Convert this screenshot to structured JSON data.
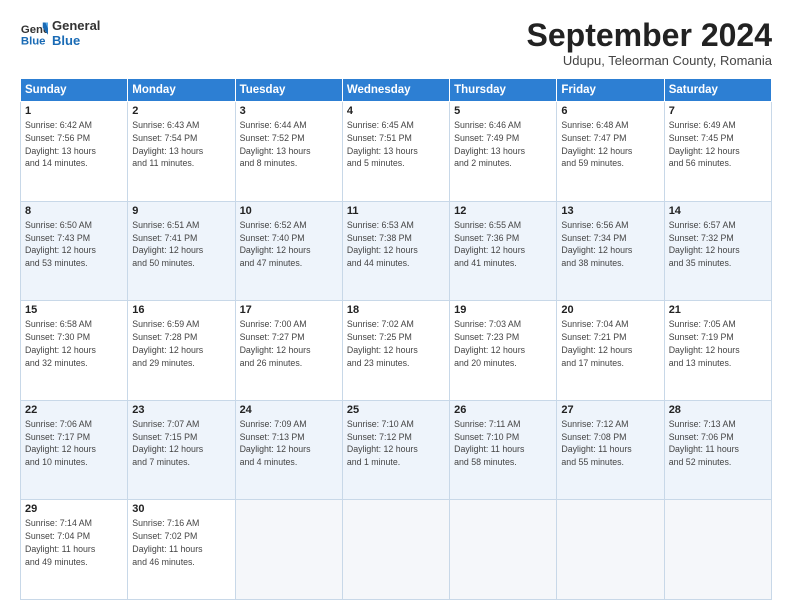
{
  "logo": {
    "line1": "General",
    "line2": "Blue"
  },
  "title": "September 2024",
  "location": "Udupu, Teleorman County, Romania",
  "header_days": [
    "Sunday",
    "Monday",
    "Tuesday",
    "Wednesday",
    "Thursday",
    "Friday",
    "Saturday"
  ],
  "weeks": [
    [
      {
        "day": "1",
        "info": "Sunrise: 6:42 AM\nSunset: 7:56 PM\nDaylight: 13 hours\nand 14 minutes."
      },
      {
        "day": "2",
        "info": "Sunrise: 6:43 AM\nSunset: 7:54 PM\nDaylight: 13 hours\nand 11 minutes."
      },
      {
        "day": "3",
        "info": "Sunrise: 6:44 AM\nSunset: 7:52 PM\nDaylight: 13 hours\nand 8 minutes."
      },
      {
        "day": "4",
        "info": "Sunrise: 6:45 AM\nSunset: 7:51 PM\nDaylight: 13 hours\nand 5 minutes."
      },
      {
        "day": "5",
        "info": "Sunrise: 6:46 AM\nSunset: 7:49 PM\nDaylight: 13 hours\nand 2 minutes."
      },
      {
        "day": "6",
        "info": "Sunrise: 6:48 AM\nSunset: 7:47 PM\nDaylight: 12 hours\nand 59 minutes."
      },
      {
        "day": "7",
        "info": "Sunrise: 6:49 AM\nSunset: 7:45 PM\nDaylight: 12 hours\nand 56 minutes."
      }
    ],
    [
      {
        "day": "8",
        "info": "Sunrise: 6:50 AM\nSunset: 7:43 PM\nDaylight: 12 hours\nand 53 minutes."
      },
      {
        "day": "9",
        "info": "Sunrise: 6:51 AM\nSunset: 7:41 PM\nDaylight: 12 hours\nand 50 minutes."
      },
      {
        "day": "10",
        "info": "Sunrise: 6:52 AM\nSunset: 7:40 PM\nDaylight: 12 hours\nand 47 minutes."
      },
      {
        "day": "11",
        "info": "Sunrise: 6:53 AM\nSunset: 7:38 PM\nDaylight: 12 hours\nand 44 minutes."
      },
      {
        "day": "12",
        "info": "Sunrise: 6:55 AM\nSunset: 7:36 PM\nDaylight: 12 hours\nand 41 minutes."
      },
      {
        "day": "13",
        "info": "Sunrise: 6:56 AM\nSunset: 7:34 PM\nDaylight: 12 hours\nand 38 minutes."
      },
      {
        "day": "14",
        "info": "Sunrise: 6:57 AM\nSunset: 7:32 PM\nDaylight: 12 hours\nand 35 minutes."
      }
    ],
    [
      {
        "day": "15",
        "info": "Sunrise: 6:58 AM\nSunset: 7:30 PM\nDaylight: 12 hours\nand 32 minutes."
      },
      {
        "day": "16",
        "info": "Sunrise: 6:59 AM\nSunset: 7:28 PM\nDaylight: 12 hours\nand 29 minutes."
      },
      {
        "day": "17",
        "info": "Sunrise: 7:00 AM\nSunset: 7:27 PM\nDaylight: 12 hours\nand 26 minutes."
      },
      {
        "day": "18",
        "info": "Sunrise: 7:02 AM\nSunset: 7:25 PM\nDaylight: 12 hours\nand 23 minutes."
      },
      {
        "day": "19",
        "info": "Sunrise: 7:03 AM\nSunset: 7:23 PM\nDaylight: 12 hours\nand 20 minutes."
      },
      {
        "day": "20",
        "info": "Sunrise: 7:04 AM\nSunset: 7:21 PM\nDaylight: 12 hours\nand 17 minutes."
      },
      {
        "day": "21",
        "info": "Sunrise: 7:05 AM\nSunset: 7:19 PM\nDaylight: 12 hours\nand 13 minutes."
      }
    ],
    [
      {
        "day": "22",
        "info": "Sunrise: 7:06 AM\nSunset: 7:17 PM\nDaylight: 12 hours\nand 10 minutes."
      },
      {
        "day": "23",
        "info": "Sunrise: 7:07 AM\nSunset: 7:15 PM\nDaylight: 12 hours\nand 7 minutes."
      },
      {
        "day": "24",
        "info": "Sunrise: 7:09 AM\nSunset: 7:13 PM\nDaylight: 12 hours\nand 4 minutes."
      },
      {
        "day": "25",
        "info": "Sunrise: 7:10 AM\nSunset: 7:12 PM\nDaylight: 12 hours\nand 1 minute."
      },
      {
        "day": "26",
        "info": "Sunrise: 7:11 AM\nSunset: 7:10 PM\nDaylight: 11 hours\nand 58 minutes."
      },
      {
        "day": "27",
        "info": "Sunrise: 7:12 AM\nSunset: 7:08 PM\nDaylight: 11 hours\nand 55 minutes."
      },
      {
        "day": "28",
        "info": "Sunrise: 7:13 AM\nSunset: 7:06 PM\nDaylight: 11 hours\nand 52 minutes."
      }
    ],
    [
      {
        "day": "29",
        "info": "Sunrise: 7:14 AM\nSunset: 7:04 PM\nDaylight: 11 hours\nand 49 minutes."
      },
      {
        "day": "30",
        "info": "Sunrise: 7:16 AM\nSunset: 7:02 PM\nDaylight: 11 hours\nand 46 minutes."
      },
      {
        "day": "",
        "info": ""
      },
      {
        "day": "",
        "info": ""
      },
      {
        "day": "",
        "info": ""
      },
      {
        "day": "",
        "info": ""
      },
      {
        "day": "",
        "info": ""
      }
    ]
  ]
}
